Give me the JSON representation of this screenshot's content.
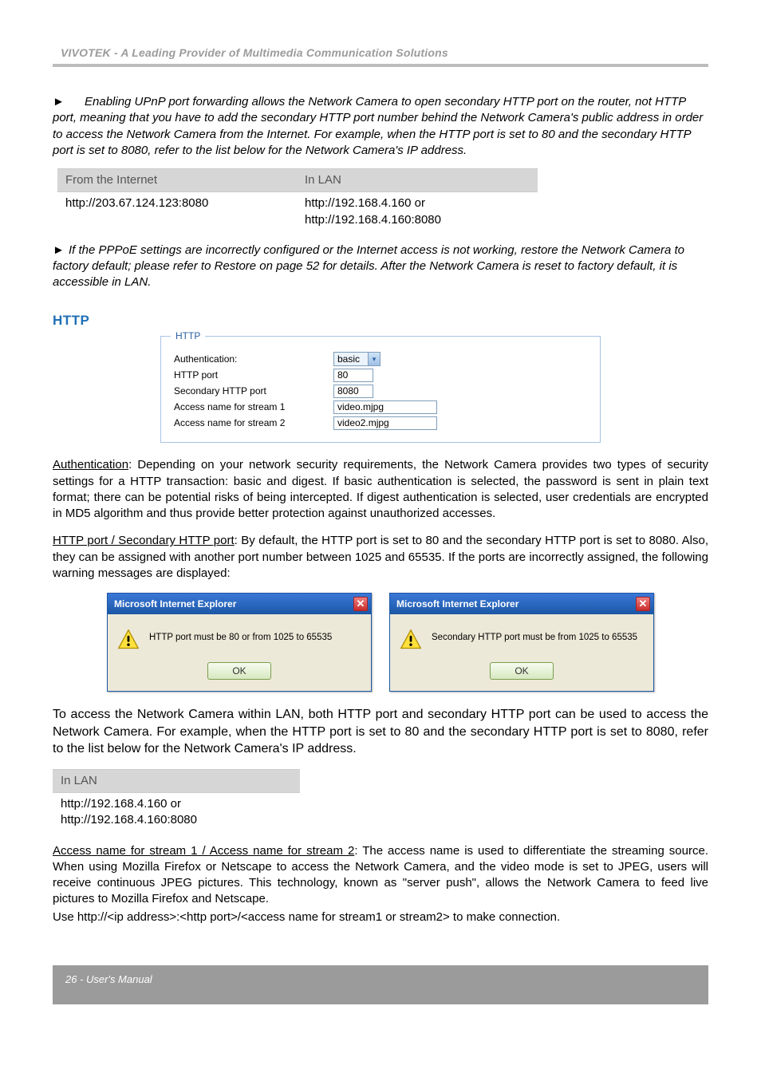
{
  "header": {
    "title": "VIVOTEK - A Leading Provider of Multimedia Communication Solutions"
  },
  "notes": {
    "arrow": "►",
    "upnp": "Enabling UPnP port forwarding allows the Network Camera to open secondary HTTP port on the router, not HTTP port, meaning that you have to add the secondary HTTP port number behind the Network Camera's public address in order to access the Network Camera from the Internet. For example, when the HTTP port is set to 80 and the secondary HTTP port is set to 8080, refer to the list below for the Network Camera's IP address.",
    "pppoe": "If the PPPoE settings are incorrectly configured or the Internet access is not working, restore the Network Camera to factory default; please refer to Restore on page 52 for details. After the Network Camera is reset to factory default, it is accessible in LAN."
  },
  "table1": {
    "h1": "From the Internet",
    "h2": "In LAN",
    "c1": "http://203.67.124.123:8080",
    "c2a": "http://192.168.4.160 or",
    "c2b": "http://192.168.4.160:8080"
  },
  "section": {
    "http": "HTTP"
  },
  "httpPanel": {
    "legend": "HTTP",
    "labels": {
      "auth": "Authentication:",
      "port": "HTTP port",
      "secport": "Secondary HTTP port",
      "s1": "Access name for stream 1",
      "s2": "Access name for stream 2"
    },
    "values": {
      "auth": "basic",
      "port": "80",
      "secport": "8080",
      "s1": "video.mjpg",
      "s2": "video2.mjpg"
    }
  },
  "body": {
    "auth_u": "Authentication",
    "auth_txt": ": Depending on your network security requirements, the Network Camera provides two types of security settings for a HTTP transaction: basic and digest. If basic authentication is selected, the password is sent in plain text format; there can be potential risks of being intercepted. If digest authentication is selected, user credentials are encrypted in MD5 algorithm and thus provide better protection against unauthorized accesses.",
    "port_u": "HTTP port / Secondary HTTP port",
    "port_txt": ": By default, the HTTP port is set to 80 and the secondary HTTP port is set to 8080. Also, they can be assigned with another port number between 1025 and 65535. If the ports are incorrectly assigned, the following warning messages are displayed:",
    "lan_txt": "To access the Network Camera within LAN, both HTTP port and secondary HTTP port can be used to access the Network Camera. For example, when the HTTP port is set to 80 and the secondary HTTP port is set to 8080, refer to the list below for the Network Camera's IP address.",
    "access_u": "Access name for stream 1 / Access name for stream 2",
    "access_txt": ": The access name is used to differentiate the streaming source. When using Mozilla Firefox or Netscape to access the Network Camera, and the video mode is set to JPEG, users will receive continuous JPEG pictures. This technology, known as \"server push\", allows the Network Camera to feed live pictures to Mozilla Firefox and Netscape.",
    "use_line": "Use http://<ip address>:<http port>/<access name for stream1 or stream2> to make connection."
  },
  "dialogs": {
    "title": "Microsoft Internet Explorer",
    "close": "✕",
    "ok": "OK",
    "msg1": "HTTP port must be 80 or from 1025 to 65535",
    "msg2": "Secondary HTTP port must be from 1025 to 65535"
  },
  "table2": {
    "h": "In LAN",
    "c1": "http://192.168.4.160 or",
    "c2": "http://192.168.4.160:8080"
  },
  "footer": {
    "text": "26 - User's Manual"
  }
}
